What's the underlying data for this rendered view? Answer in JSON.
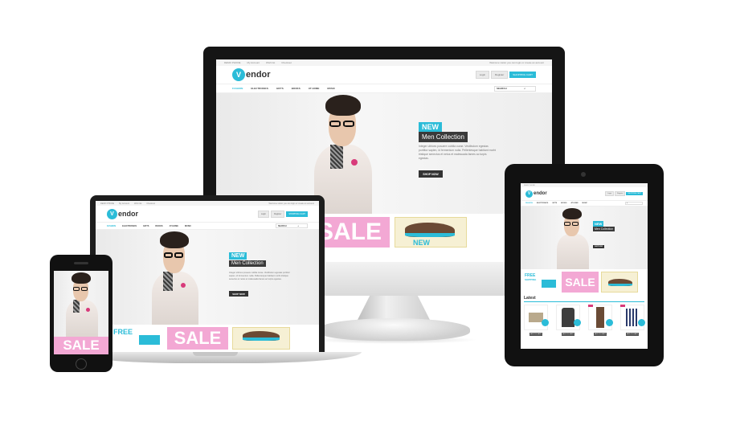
{
  "brand": {
    "logo_initial": "V",
    "logo_rest": "endor",
    "accent_color": "#2bbcd8",
    "sale_color": "#f3a8d4",
    "dark_color": "#3a3a3a"
  },
  "topbar": {
    "links": [
      "DEMO PHONE",
      "My Account",
      "Wish list",
      "Checkout"
    ],
    "welcome": "Welcome visitor you can login or create an account"
  },
  "header": {
    "login_label": "Login",
    "register_label": "Register",
    "cart_label": "SHOPPING CART"
  },
  "nav": {
    "items": [
      "FASHION",
      "ELECTRONICS",
      "GIFTS",
      "BOOKS",
      "AT HOME",
      "MUSIC"
    ],
    "active_index": 0,
    "search_placeholder": "Search"
  },
  "hero": {
    "tag_new": "NEW",
    "tag_collection": "Men Collection",
    "description": "Integer ultrices posuere cubilia curae. Vestibulum egestas porttitor sapien, id fermentum nulla. Pellentesque habitant morbi tristique senectus et netus et malesuada fames ac turpis egestas.",
    "shop_button": "SHOP NOW"
  },
  "promos": {
    "free_label": "FREE",
    "free_sub": "SHIPPING",
    "sale_label": "SALE",
    "arrivals_label": "NEW ARRIVALS"
  },
  "latest": {
    "title": "Latest",
    "products": [
      {
        "name": "shorts",
        "button": "ADD TO CART"
      },
      {
        "name": "jacket",
        "button": "ADD TO CART"
      },
      {
        "name": "pants",
        "button": "ADD TO CART"
      },
      {
        "name": "shirt",
        "button": "ADD TO CART"
      }
    ]
  },
  "icons": {
    "search": "search-icon"
  }
}
